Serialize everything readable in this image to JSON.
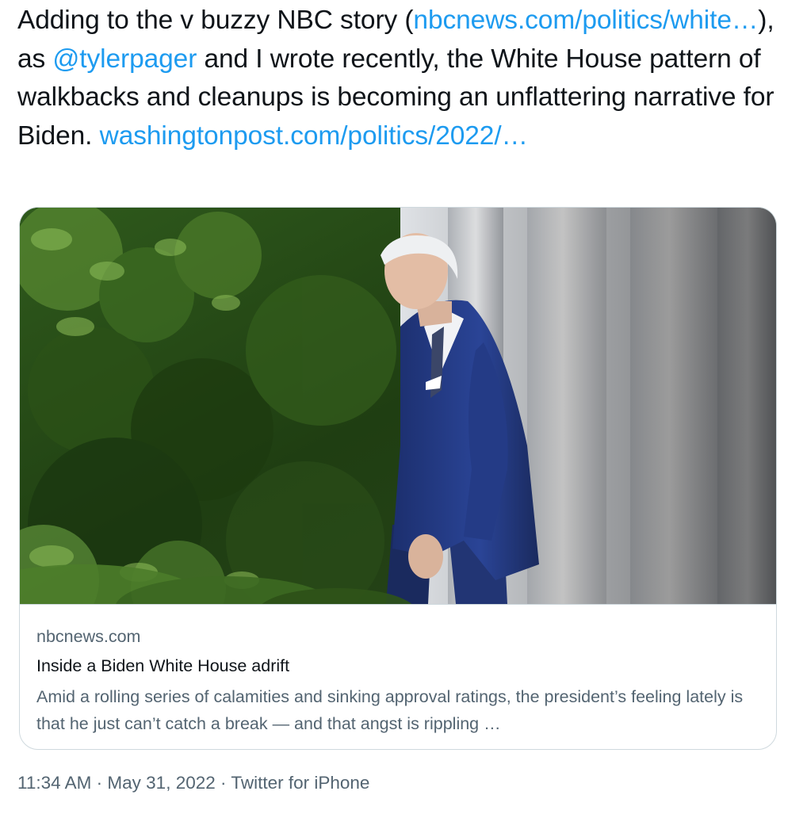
{
  "tweet": {
    "text_1": "Adding to the v buzzy NBC story (",
    "link_1": "nbcnews.com/politics/white…",
    "text_2": "), as ",
    "mention": "@tylerpager",
    "text_3": " and I wrote recently, the White House pattern of walkbacks and cleanups is becoming an unflattering narrative for Biden. ",
    "link_2": "washingtonpost.com/politics/2022/…"
  },
  "card": {
    "domain": "nbcnews.com",
    "title": "Inside a Biden White House adrift",
    "description": "Amid a rolling series of calamities and sinking approval ratings, the president’s feeling lately is that he just can’t catch a break — and that angst is rippling …"
  },
  "meta": {
    "time": "11:34 AM",
    "separator_1": " · ",
    "date": "May 31, 2022",
    "separator_2": " · ",
    "source": "Twitter for iPhone"
  },
  "colors": {
    "link": "#1d9bf0",
    "text": "#0f1419",
    "muted": "#536471",
    "border": "#cfd9de"
  }
}
